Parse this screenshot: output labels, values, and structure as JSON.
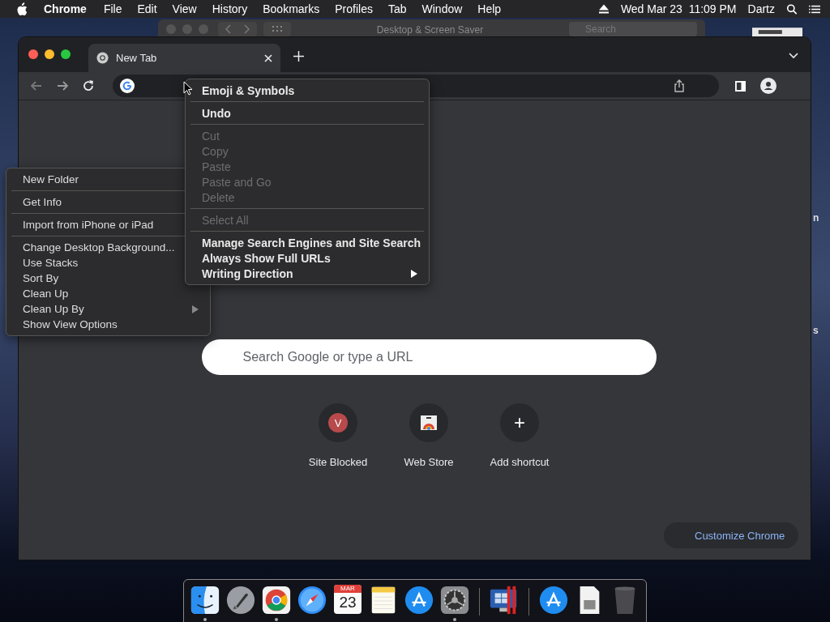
{
  "menu_bar": {
    "app_name": "Chrome",
    "items": [
      "File",
      "Edit",
      "View",
      "History",
      "Bookmarks",
      "Profiles",
      "Tab",
      "Window",
      "Help"
    ],
    "clock": "Wed Mar 23  11:09 PM",
    "user": "Dartz"
  },
  "background_window": {
    "title": "Desktop & Screen Saver",
    "search_placeholder": "Search"
  },
  "desktop_labels": [
    "n",
    "s"
  ],
  "browser": {
    "tabs": [
      {
        "title": "New Tab",
        "selected": true
      }
    ],
    "search_placeholder": "Search Google or type a URL",
    "shortcuts": [
      {
        "kind": "letter",
        "letter": "V",
        "label": "Site Blocked"
      },
      {
        "kind": "store",
        "label": "Web Store"
      },
      {
        "kind": "add",
        "symbol": "+",
        "label": "Add shortcut"
      }
    ],
    "customize_button": "Customize Chrome"
  },
  "context_menu": {
    "groups": [
      {
        "items": [
          {
            "label": "Emoji & Symbols",
            "disabled": false,
            "submenu": false
          }
        ]
      },
      {
        "items": [
          {
            "label": "Undo",
            "disabled": false,
            "submenu": false
          }
        ]
      },
      {
        "items": [
          {
            "label": "Cut",
            "disabled": true,
            "submenu": false
          },
          {
            "label": "Copy",
            "disabled": true,
            "submenu": false
          },
          {
            "label": "Paste",
            "disabled": true,
            "submenu": false
          },
          {
            "label": "Paste and Go",
            "disabled": true,
            "submenu": false
          },
          {
            "label": "Delete",
            "disabled": true,
            "submenu": false
          }
        ]
      },
      {
        "items": [
          {
            "label": "Select All",
            "disabled": true,
            "submenu": false
          }
        ]
      },
      {
        "items": [
          {
            "label": "Manage Search Engines and Site Search",
            "disabled": false,
            "submenu": false
          },
          {
            "label": "Always Show Full URLs",
            "disabled": false,
            "submenu": false
          },
          {
            "label": "Writing Direction",
            "disabled": false,
            "submenu": true
          }
        ]
      }
    ]
  },
  "desktop_menu": {
    "groups": [
      {
        "items": [
          {
            "label": "New Folder",
            "disabled": false,
            "submenu": false
          }
        ]
      },
      {
        "items": [
          {
            "label": "Get Info",
            "disabled": false,
            "submenu": false
          }
        ]
      },
      {
        "items": [
          {
            "label": "Import from iPhone or iPad",
            "disabled": false,
            "submenu": false
          }
        ]
      },
      {
        "items": [
          {
            "label": "Change Desktop Background...",
            "disabled": false,
            "submenu": false
          },
          {
            "label": "Use Stacks",
            "disabled": false,
            "submenu": false
          },
          {
            "label": "Sort By",
            "disabled": false,
            "submenu": false
          },
          {
            "label": "Clean Up",
            "disabled": false,
            "submenu": false
          },
          {
            "label": "Clean Up By",
            "disabled": false,
            "submenu": true
          },
          {
            "label": "Show View Options",
            "disabled": false,
            "submenu": false
          }
        ]
      }
    ]
  },
  "dock": {
    "items": [
      {
        "kind": "finder",
        "running": true
      },
      {
        "kind": "launchpad",
        "running": false
      },
      {
        "kind": "chrome",
        "running": true
      },
      {
        "kind": "safari",
        "running": false
      },
      {
        "kind": "calendar",
        "month": "MAR",
        "day": "23",
        "running": false
      },
      {
        "kind": "notes",
        "running": false
      },
      {
        "kind": "appstore",
        "running": false
      },
      {
        "kind": "settings",
        "running": true
      },
      {
        "kind": "divider"
      },
      {
        "kind": "parallels",
        "running": false
      },
      {
        "kind": "divider"
      },
      {
        "kind": "appstore",
        "running": false
      },
      {
        "kind": "document",
        "running": false
      },
      {
        "kind": "trash",
        "running": false
      }
    ]
  }
}
